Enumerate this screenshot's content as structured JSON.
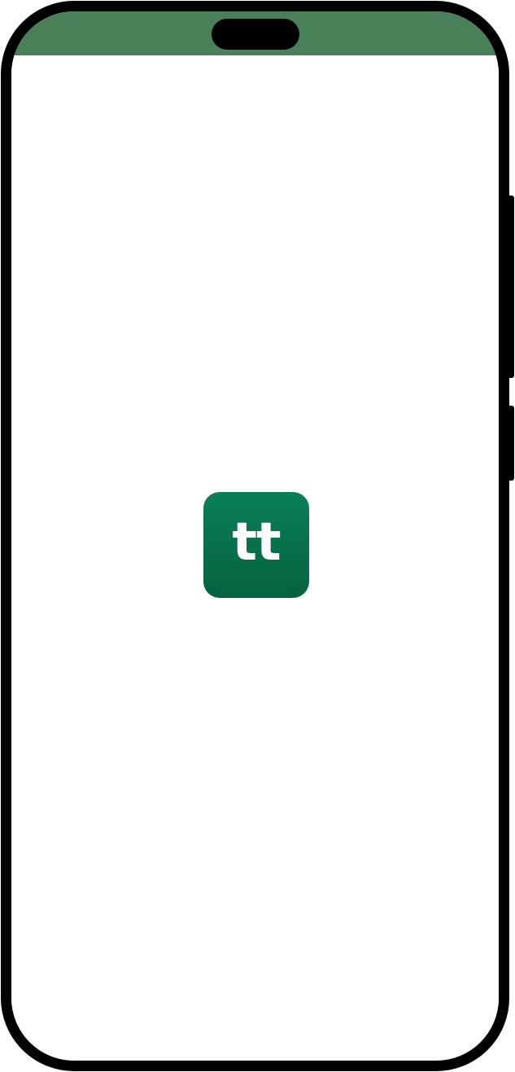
{
  "device": {
    "status_bar_color": "#4a8058",
    "frame_color": "#000000"
  },
  "splash": {
    "logo_text": "tt",
    "logo_color_top": "#0a7f56",
    "logo_color_bottom": "#06633f",
    "background": "#ffffff"
  }
}
